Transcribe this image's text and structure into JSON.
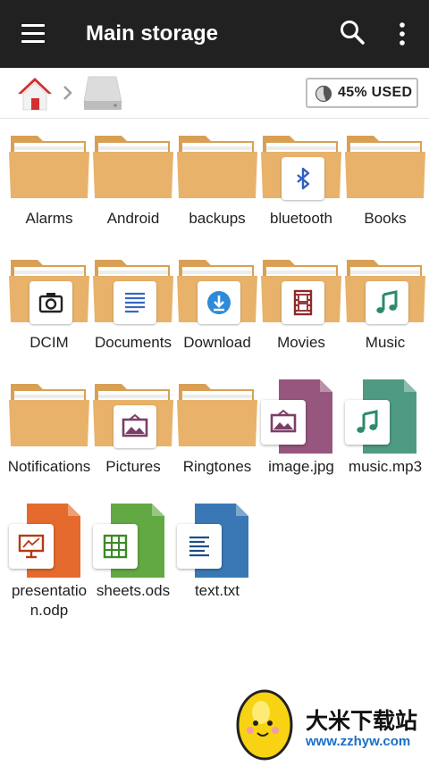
{
  "toolbar": {
    "title": "Main storage",
    "menu_icon": "menu-icon",
    "search_icon": "search-icon",
    "more_icon": "more-vert-icon"
  },
  "pathbar": {
    "home_icon": "home-icon",
    "separator_icon": "chevron-right-icon",
    "storage_icon": "storage-drive-icon",
    "usage_percent": 45,
    "usage_label": "45% USED"
  },
  "colors": {
    "appbar": "#212121",
    "folder": "#E8B26A",
    "folder_back": "#D9A055",
    "image_file": "#96567E",
    "audio_file": "#4E9A83",
    "presentation_file": "#E46B2D",
    "sheet_file": "#62A843",
    "text_file": "#3A78B5"
  },
  "items": [
    {
      "name": "Alarms",
      "kind": "folder",
      "icon": ""
    },
    {
      "name": "Android",
      "kind": "folder",
      "icon": ""
    },
    {
      "name": "backups",
      "kind": "folder",
      "icon": ""
    },
    {
      "name": "bluetooth",
      "kind": "folder",
      "icon": "bluetooth-icon"
    },
    {
      "name": "Books",
      "kind": "folder",
      "icon": ""
    },
    {
      "name": "DCIM",
      "kind": "folder",
      "icon": "camera-icon"
    },
    {
      "name": "Documents",
      "kind": "folder",
      "icon": "document-icon"
    },
    {
      "name": "Download",
      "kind": "folder",
      "icon": "download-icon"
    },
    {
      "name": "Movies",
      "kind": "folder",
      "icon": "film-icon"
    },
    {
      "name": "Music",
      "kind": "folder",
      "icon": "music-note-icon"
    },
    {
      "name": "Notifications",
      "kind": "folder",
      "icon": ""
    },
    {
      "name": "Pictures",
      "kind": "folder",
      "icon": "picture-icon"
    },
    {
      "name": "Ringtones",
      "kind": "folder",
      "icon": ""
    },
    {
      "name": "image.jpg",
      "kind": "file",
      "icon": "picture-icon"
    },
    {
      "name": "music.mp3",
      "kind": "file",
      "icon": "music-note-icon"
    },
    {
      "name": "presentation.odp",
      "kind": "file",
      "icon": "presentation-icon"
    },
    {
      "name": "sheets.ods",
      "kind": "file",
      "icon": "spreadsheet-icon"
    },
    {
      "name": "text.txt",
      "kind": "file",
      "icon": "text-lines-icon"
    }
  ],
  "watermark": {
    "title": "大米下载站",
    "url": "www.zzhyw.com"
  }
}
